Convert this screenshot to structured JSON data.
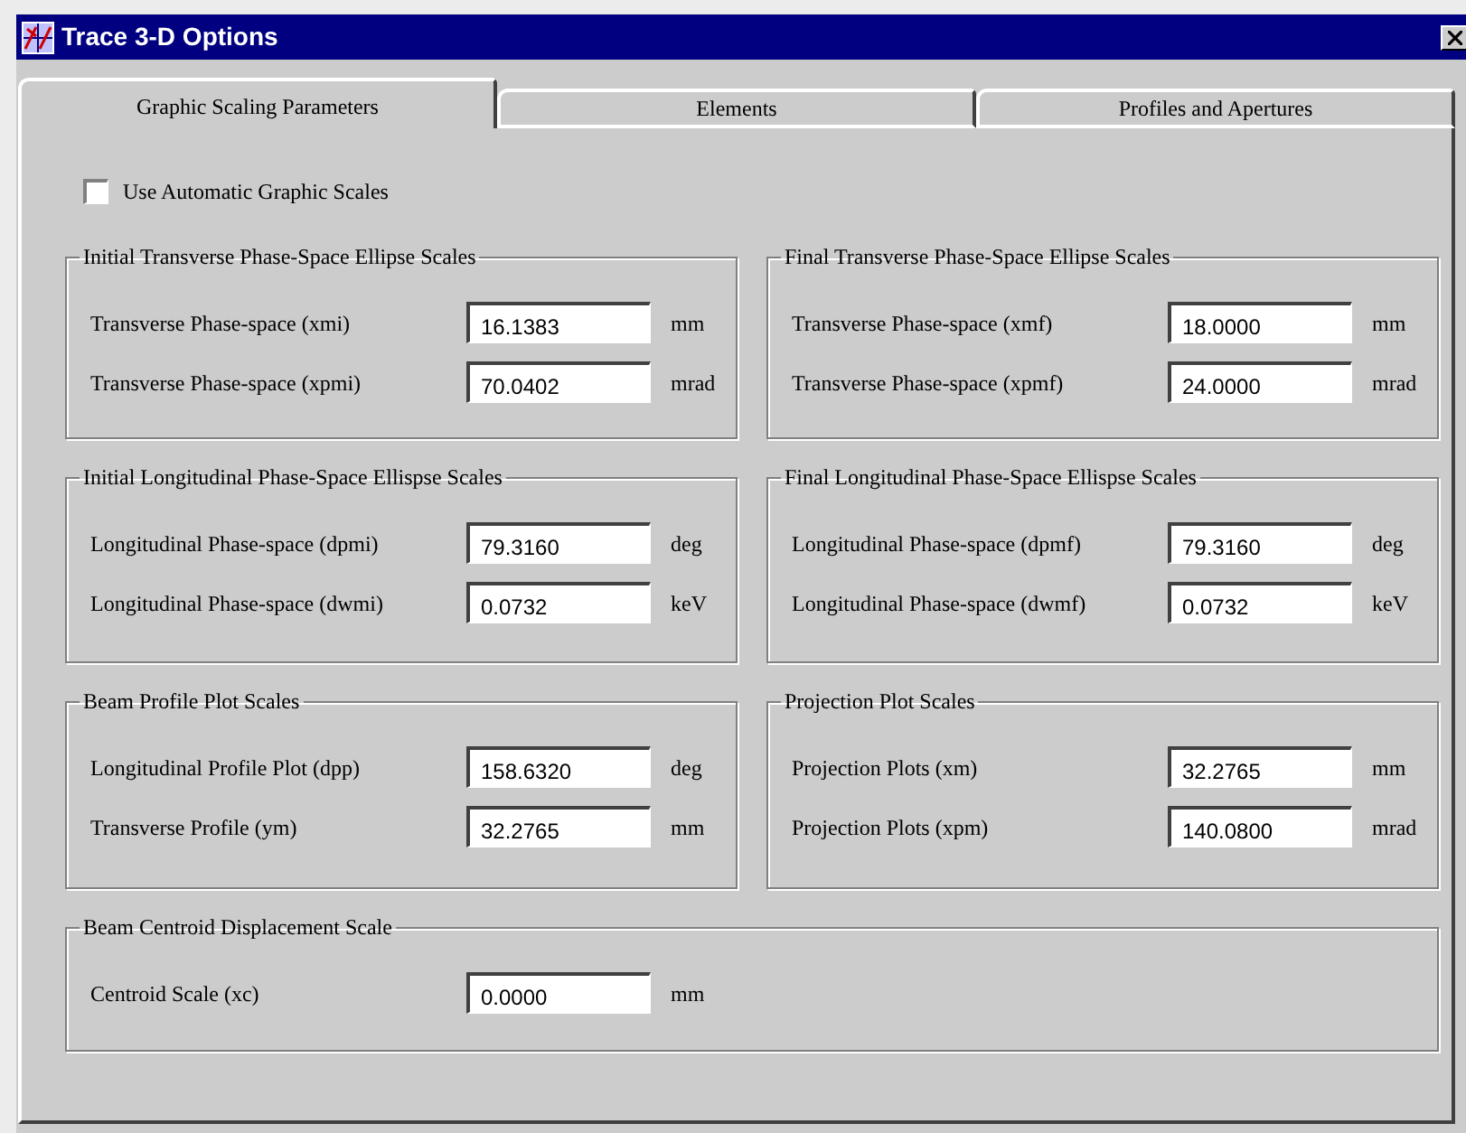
{
  "window": {
    "title": "Trace 3-D Options"
  },
  "tabs": [
    {
      "label": "Graphic Scaling Parameters",
      "selected": true
    },
    {
      "label": "Elements",
      "selected": false
    },
    {
      "label": "Profiles and Apertures",
      "selected": false
    }
  ],
  "auto_scales": {
    "label": "Use Automatic Graphic Scales",
    "checked": false
  },
  "groups": [
    {
      "title": "Initial Transverse Phase-Space Ellipse Scales",
      "fields": [
        {
          "label": "Transverse Phase-space (xmi)",
          "value": "16.1383",
          "unit": "mm"
        },
        {
          "label": "Transverse Phase-space (xpmi)",
          "value": "70.0402",
          "unit": "mrad"
        }
      ]
    },
    {
      "title": "Final Transverse Phase-Space Ellipse Scales",
      "fields": [
        {
          "label": "Transverse Phase-space (xmf)",
          "value": "18.0000",
          "unit": "mm"
        },
        {
          "label": "Transverse Phase-space (xpmf)",
          "value": "24.0000",
          "unit": "mrad"
        }
      ]
    },
    {
      "title": "Initial Longitudinal Phase-Space Ellispse Scales",
      "fields": [
        {
          "label": "Longitudinal Phase-space (dpmi)",
          "value": "79.3160",
          "unit": "deg"
        },
        {
          "label": "Longitudinal Phase-space (dwmi)",
          "value": "0.0732",
          "unit": "keV"
        }
      ]
    },
    {
      "title": "Final Longitudinal Phase-Space Ellispse Scales",
      "fields": [
        {
          "label": "Longitudinal Phase-space (dpmf)",
          "value": "79.3160",
          "unit": "deg"
        },
        {
          "label": "Longitudinal Phase-space (dwmf)",
          "value": "0.0732",
          "unit": "keV"
        }
      ]
    },
    {
      "title": "Beam Profile Plot Scales",
      "fields": [
        {
          "label": "Longitudinal Profile Plot (dpp)",
          "value": "158.6320",
          "unit": "deg"
        },
        {
          "label": "Transverse Profile (ym)",
          "value": "32.2765",
          "unit": "mm"
        }
      ]
    },
    {
      "title": "Projection Plot Scales",
      "fields": [
        {
          "label": "Projection Plots (xm)",
          "value": "32.2765",
          "unit": "mm"
        },
        {
          "label": "Projection Plots (xpm)",
          "value": "140.0800",
          "unit": "mrad"
        }
      ]
    },
    {
      "title": "Beam Centroid Displacement Scale",
      "fields": [
        {
          "label": "Centroid Scale (xc)",
          "value": "0.0000",
          "unit": "mm"
        }
      ]
    }
  ]
}
